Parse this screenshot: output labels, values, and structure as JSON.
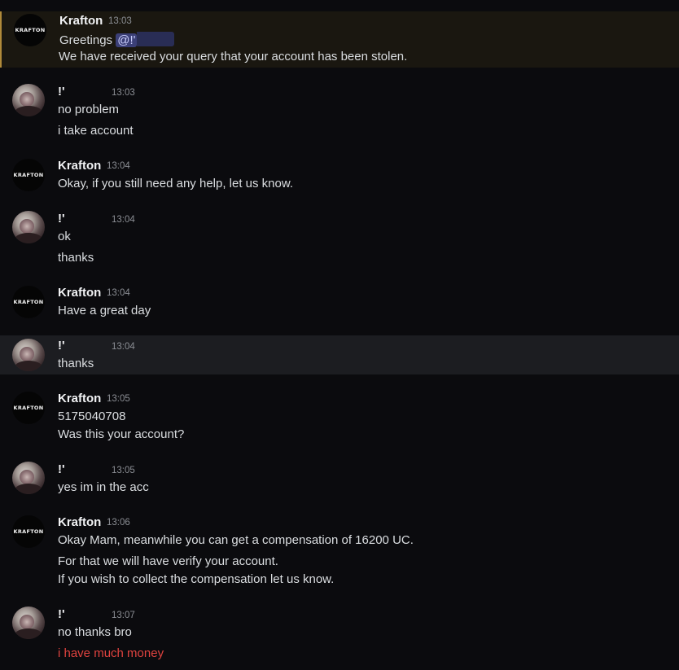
{
  "messages": [
    {
      "author": "Krafton",
      "time": "13:03",
      "greeting": "Greetings",
      "mention": "@!'",
      "lines": [
        " We have received your query that your account has been stolen."
      ]
    },
    {
      "author": "!'",
      "time": "13:03",
      "lines": [
        "no problem",
        "i take account"
      ]
    },
    {
      "author": "Krafton",
      "time": "13:04",
      "lines": [
        "Okay, if you still need any help, let us know."
      ]
    },
    {
      "author": "!'",
      "time": "13:04",
      "lines": [
        "ok",
        "thanks"
      ]
    },
    {
      "author": "Krafton",
      "time": "13:04",
      "lines": [
        "Have a great day"
      ]
    },
    {
      "author": "!'",
      "time": "13:04",
      "lines": [
        "thanks"
      ]
    },
    {
      "author": "Krafton",
      "time": "13:05",
      "lines": [
        "5175040708",
        "Was this your account?"
      ]
    },
    {
      "author": "!'",
      "time": "13:05",
      "lines": [
        "yes im in the acc"
      ]
    },
    {
      "author": "Krafton",
      "time": "13:06",
      "lines": [
        "Okay Mam, meanwhile you can get a compensation of 16200 UC.",
        "For that we will have verify your account.",
        "If you wish to collect the compensation let us know."
      ]
    },
    {
      "author": "!'",
      "time": "13:07",
      "lines": [
        "no thanks bro",
        "i have much money"
      ]
    }
  ],
  "avatar_logo_text": "KRAFTON",
  "colors": {
    "background": "#0b0b0e",
    "highlight_bar": "#b08a3a",
    "mention": "#3b3f77",
    "red_text": "#e0433f"
  }
}
